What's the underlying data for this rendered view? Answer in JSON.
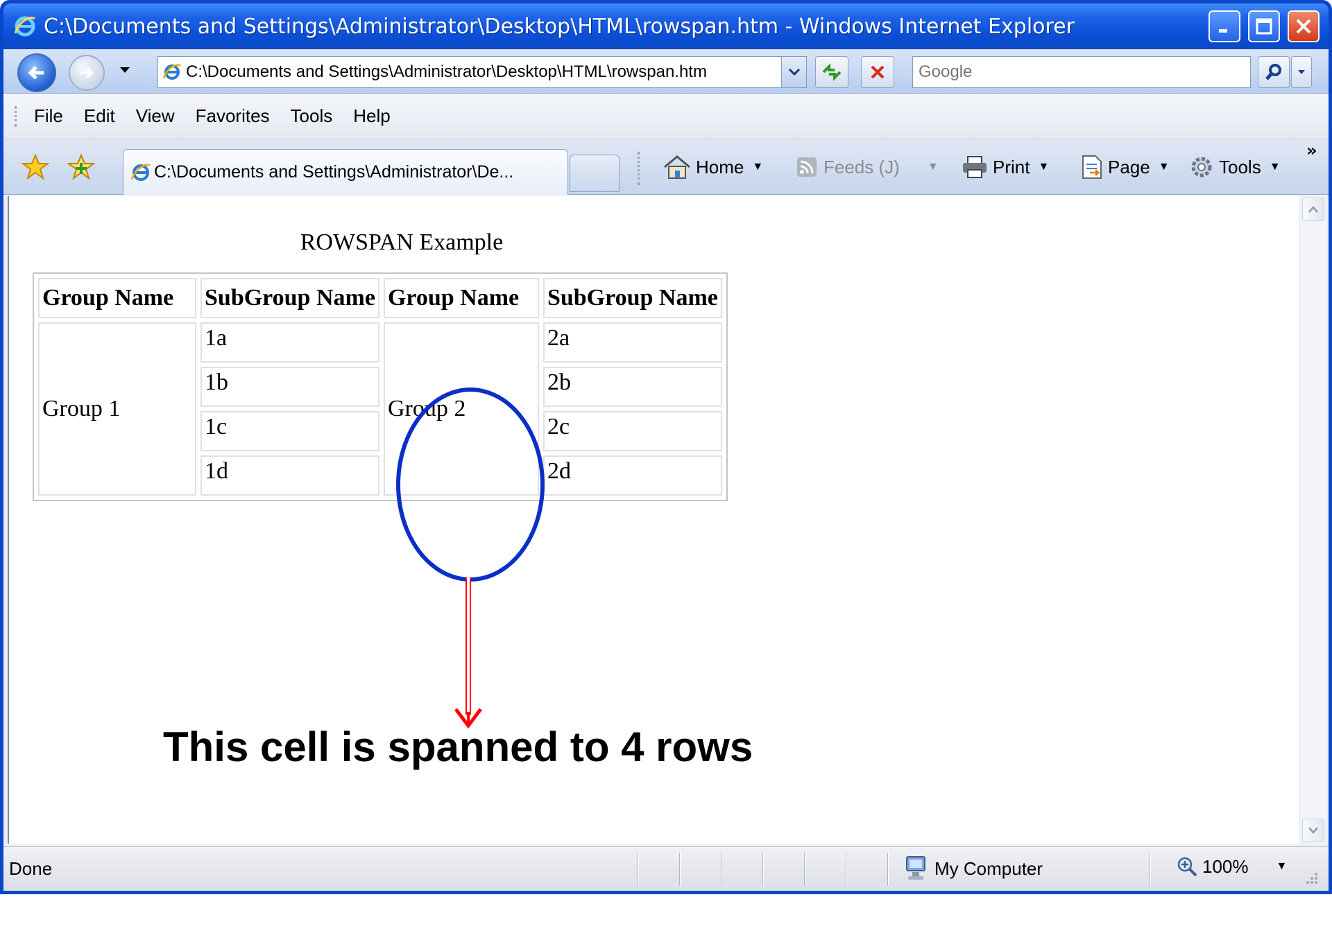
{
  "window": {
    "title": "C:\\Documents and Settings\\Administrator\\Desktop\\HTML\\rowspan.htm - Windows Internet Explorer"
  },
  "navbar": {
    "address": "C:\\Documents and Settings\\Administrator\\Desktop\\HTML\\rowspan.htm",
    "search_placeholder": "Google"
  },
  "menu": [
    "File",
    "Edit",
    "View",
    "Favorites",
    "Tools",
    "Help"
  ],
  "tabs": {
    "active_label": "C:\\Documents and Settings\\Administrator\\De..."
  },
  "commands": {
    "home": "Home",
    "feeds": "Feeds (J)",
    "print": "Print",
    "page": "Page",
    "tools": "Tools"
  },
  "page": {
    "caption": "ROWSPAN Example",
    "headers": [
      "Group Name",
      "SubGroup Name",
      "Group Name",
      "SubGroup Name"
    ],
    "group1": "Group 1",
    "group2": "Group 2",
    "subgroups1": [
      "1a",
      "1b",
      "1c",
      "1d"
    ],
    "subgroups2": [
      "2a",
      "2b",
      "2c",
      "2d"
    ]
  },
  "annotation": {
    "text": "This cell is spanned to 4 rows",
    "ellipse_color": "#0a2fc8",
    "arrow_color": "#ff0000"
  },
  "status": {
    "text": "Done",
    "zone": "My Computer",
    "zoom": "100%"
  },
  "icons": [
    "ie-logo-icon",
    "minimize-icon",
    "maximize-icon",
    "close-icon",
    "back-arrow-icon",
    "forward-arrow-icon",
    "refresh-icon",
    "stop-icon",
    "search-icon",
    "favorites-star-icon",
    "add-favorite-icon",
    "home-icon",
    "feeds-icon",
    "print-icon",
    "page-icon",
    "tools-gear-icon",
    "computer-icon",
    "zoom-icon"
  ]
}
